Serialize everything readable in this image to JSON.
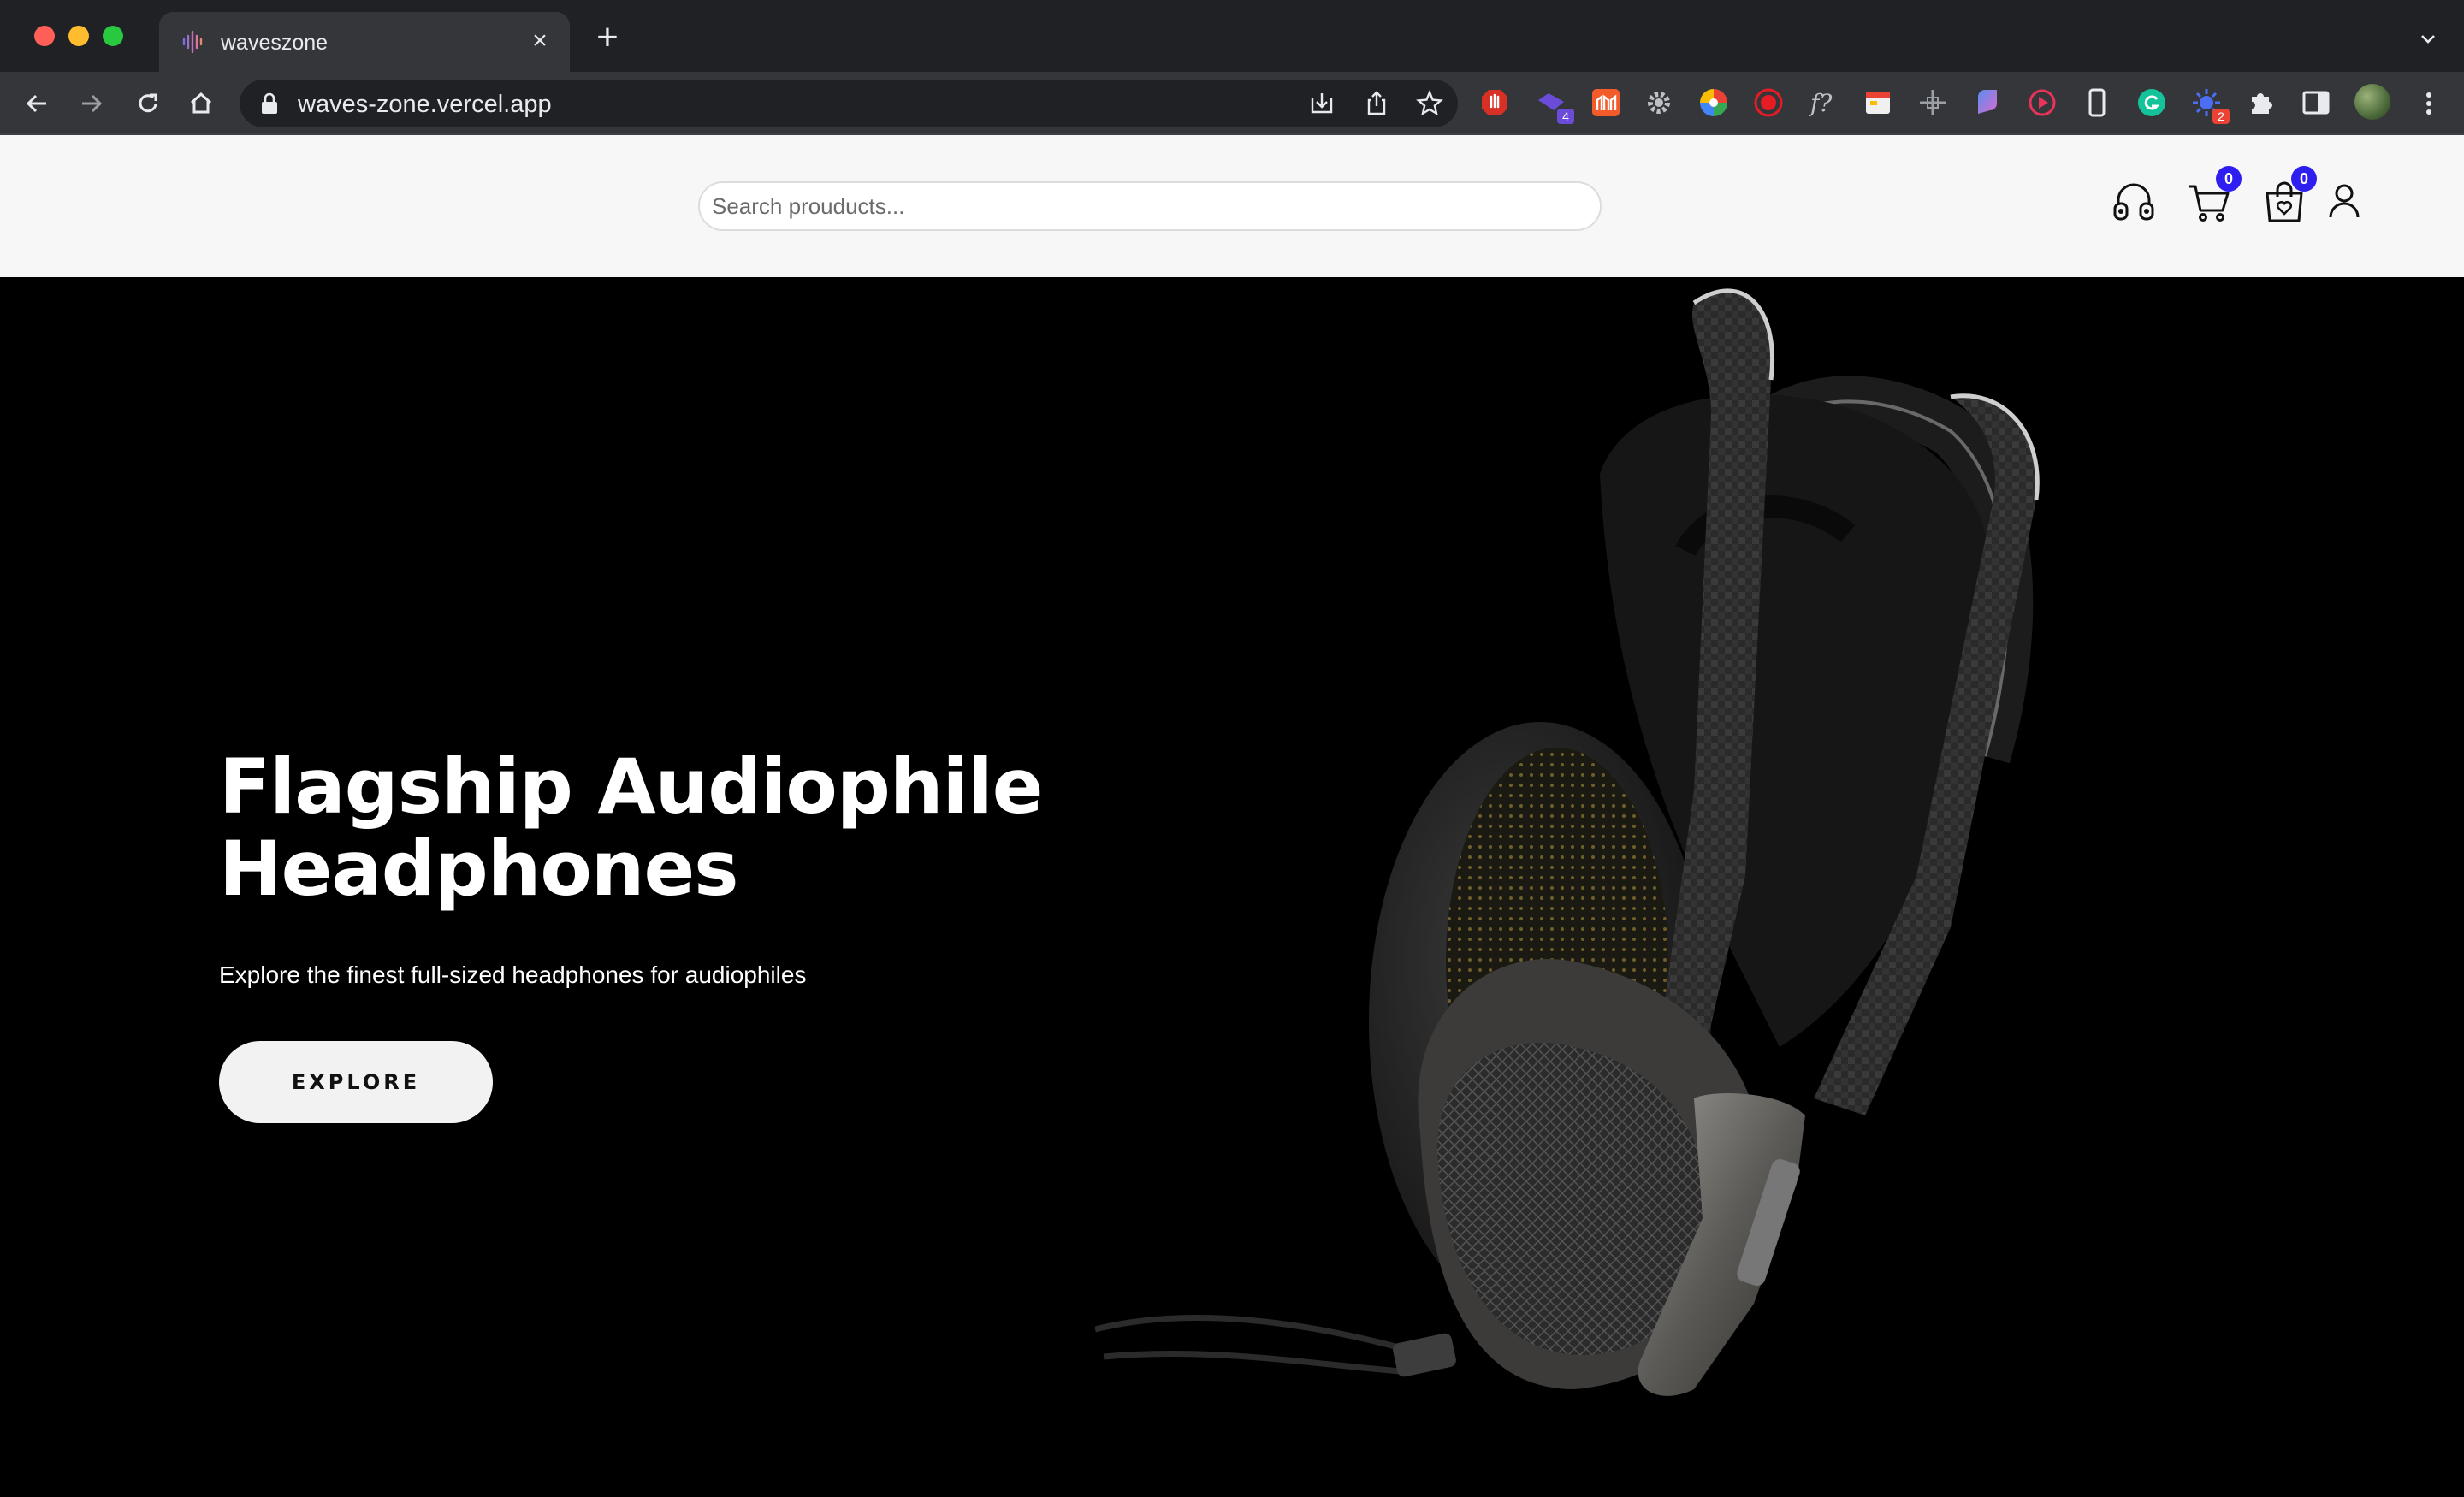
{
  "browser": {
    "tab_title": "waveszone",
    "url": "waves-zone.vercel.app",
    "extensions": [
      {
        "name": "adblock-icon",
        "color": "#d93025"
      },
      {
        "name": "extension-purple-icon",
        "color": "#6a4cd9",
        "badge": "4",
        "badge_color": "#6a4cd9"
      },
      {
        "name": "extension-orange-icon",
        "color": "#f35b2b"
      },
      {
        "name": "gear-extension-icon",
        "color": "#bdc1c6"
      },
      {
        "name": "colorwheel-icon",
        "color": "#e8eaed"
      },
      {
        "name": "record-icon",
        "color": "#e51c23"
      },
      {
        "name": "font-finder-icon",
        "color": "#bdc1c6"
      },
      {
        "name": "calendar-extension-icon",
        "color": "#f0f0f0"
      },
      {
        "name": "ruler-extension-icon",
        "color": "#9aa0a6"
      },
      {
        "name": "extension-gradient-icon",
        "color": "#8e6bf5"
      },
      {
        "name": "play-extension-icon",
        "color": "#e8335a"
      },
      {
        "name": "device-extension-icon",
        "color": "#e8eaed"
      },
      {
        "name": "grammarly-icon",
        "color": "#15c39a"
      },
      {
        "name": "extension-blue-icon",
        "color": "#4c6ef5",
        "badge": "2",
        "badge_color": "#ea4335"
      },
      {
        "name": "puzzle-icon",
        "color": "#e8eaed"
      },
      {
        "name": "sidepanel-icon",
        "color": "#e8eaed"
      }
    ]
  },
  "header": {
    "search_placeholder": "Search prouducts...",
    "cart_count": "0",
    "wishlist_count": "0"
  },
  "hero": {
    "title_line1": "Flagship Audiophile",
    "title_line2": "Headphones",
    "subtitle": "Explore the finest full-sized headphones for audiophiles",
    "button_label": "EXPLORE"
  },
  "colors": {
    "accent_badge": "#2f1ef0",
    "hero_bg": "#000000",
    "header_bg": "#f7f7f7"
  }
}
